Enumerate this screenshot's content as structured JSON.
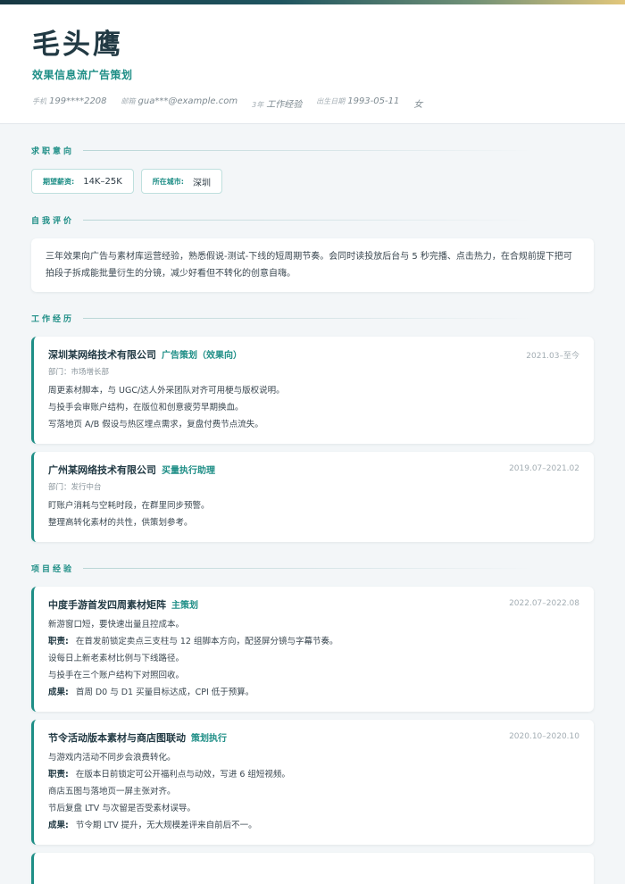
{
  "header": {
    "name": "毛头鹰",
    "title": "效果信息流广告策划",
    "meta": [
      {
        "label": "手机",
        "value": "199****2208"
      },
      {
        "label": "邮箱",
        "value": "gua***@example.com"
      },
      {
        "label": "3年",
        "value": "工作经验"
      },
      {
        "label": "出生日期",
        "value": "1993-05-11"
      },
      {
        "label": "",
        "value": "女"
      }
    ]
  },
  "sections": {
    "intent": "求职意向",
    "summary": "自我评价",
    "work": "工作经历",
    "projects": "项目经验"
  },
  "intent": {
    "salary_label": "期望薪资:",
    "salary_value": "14K–25K",
    "city_label": "所在城市:",
    "city_value": "深圳"
  },
  "summary_text": "三年效果向广告与素材库运营经验，熟悉假说-测试-下线的短周期节奏。会同时读投放后台与 5 秒完播、点击热力，在合规前提下把可拍段子拆成能批量衍生的分镜，减少好看但不转化的创意自嗨。",
  "work": [
    {
      "org": "深圳某网络技术有限公司",
      "role": "广告策划（效果向）",
      "period": "2021.03–至今",
      "dept": "部门：市场增长部",
      "lines": [
        "周更素材脚本，与 UGC/达人外采团队对齐可用梗与版权说明。",
        "与投手会审账户结构，在版位和创意疲劳早期换血。",
        "写落地页 A/B 假设与热区埋点需求，复盘付费节点流失。"
      ]
    },
    {
      "org": "广州某网络技术有限公司",
      "role": "买量执行助理",
      "period": "2019.07–2021.02",
      "dept": "部门：发行中台",
      "lines": [
        "盯账户消耗与空耗时段，在群里同步预警。",
        "整理高转化素材的共性，供策划参考。"
      ]
    }
  ],
  "projects": [
    {
      "org": "中度手游首发四周素材矩阵",
      "role": "主策划",
      "period": "2022.07–2022.08",
      "intro": "新游窗口短，要快速出量且控成本。",
      "duty_label": "职责:",
      "duty": "在首发前锁定卖点三支柱与 12 组脚本方向，配竖屏分镜与字幕节奏。",
      "lines": [
        "设每日上新老素材比例与下线路径。",
        "与投手在三个账户结构下对照回收。"
      ],
      "result_label": "成果:",
      "result": "首周 D0 与 D1 买量目标达成，CPI 低于预算。"
    },
    {
      "org": "节令活动版本素材与商店图联动",
      "role": "策划执行",
      "period": "2020.10–2020.10",
      "intro": "与游戏内活动不同步会浪费转化。",
      "duty_label": "职责:",
      "duty": "在版本日前锁定可公开福利点与动效，写进 6 组短视频。",
      "lines": [
        "商店五图与落地页一屏主张对齐。",
        "节后复盘 LTV 与次留是否受素材误导。"
      ],
      "result_label": "成果:",
      "result": "节令期 LTV 提升，无大规模差评来自前后不一。"
    }
  ]
}
